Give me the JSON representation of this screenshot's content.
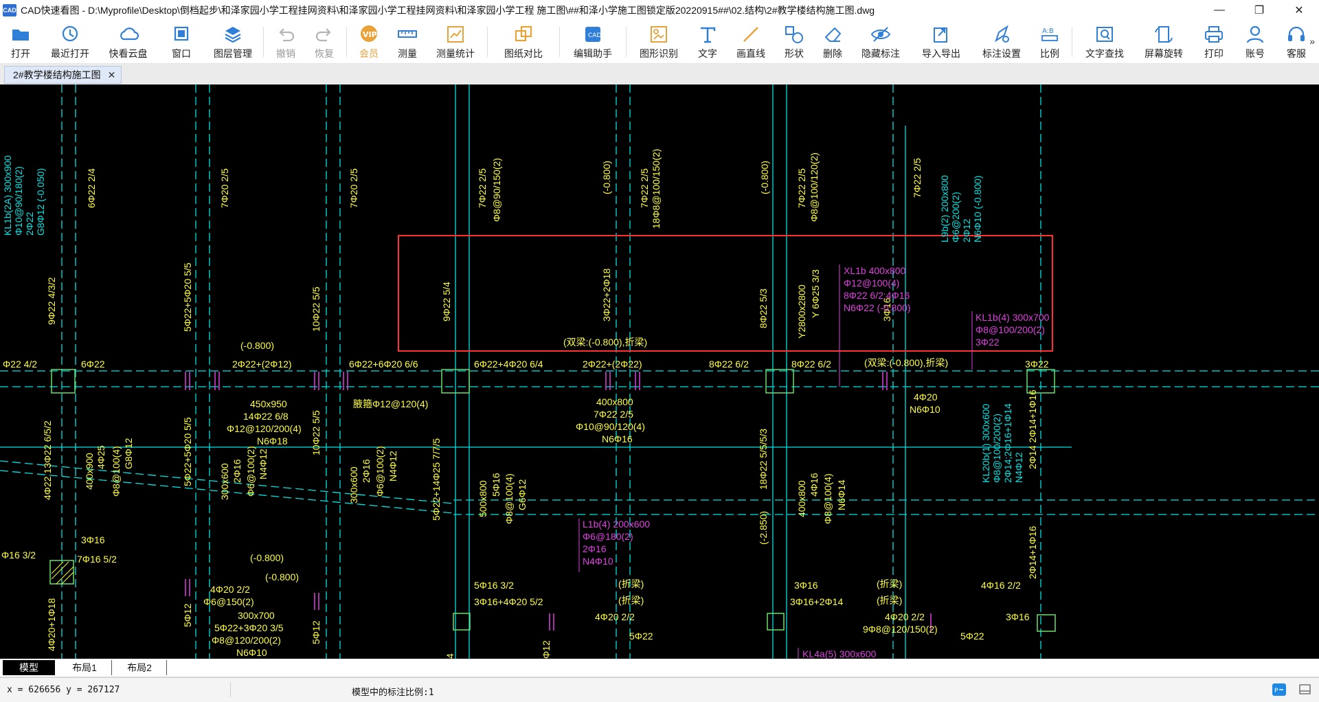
{
  "window": {
    "title": "CAD快速看图 - D:\\Myprofile\\Desktop\\倒档起步\\和泽家园小学工程挂网资料\\和泽家园小学工程挂网资料\\和泽家园小学工程 施工图\\##和泽小学施工图锁定版20220915##\\02.结构\\2#教学楼结构施工图.dwg",
    "app_icon_text": "CAD",
    "minimize": "—",
    "maximize": "❐",
    "close": "✕"
  },
  "toolbar": {
    "items": [
      {
        "label": "打开",
        "icon": "folder-open-icon",
        "color": "#2f7fd8"
      },
      {
        "label": "最近打开",
        "icon": "history-icon",
        "color": "#2f7fd8"
      },
      {
        "label": "快看云盘",
        "icon": "cloud-icon",
        "color": "#2f7fd8"
      },
      {
        "label": "窗口",
        "icon": "window-icon",
        "color": "#2f7fd8"
      },
      {
        "label": "图层管理",
        "icon": "layers-icon",
        "color": "#2f7fd8"
      },
      {
        "label": "撤销",
        "icon": "undo-icon",
        "color": "#b5b5b5"
      },
      {
        "label": "恢复",
        "icon": "redo-icon",
        "color": "#b5b5b5"
      },
      {
        "label": "会员",
        "icon": "vip-icon",
        "color": "#e8a23a"
      },
      {
        "label": "测量",
        "icon": "ruler-icon",
        "color": "#2f7fd8"
      },
      {
        "label": "测量统计",
        "icon": "measure-stats-icon",
        "color": "#e8a23a"
      },
      {
        "label": "图纸对比",
        "icon": "compare-icon",
        "color": "#e8a23a"
      },
      {
        "label": "编辑助手",
        "icon": "edit-assistant-icon",
        "color": "#2f7fd8"
      },
      {
        "label": "图形识别",
        "icon": "shape-recognition-icon",
        "color": "#e8a23a"
      },
      {
        "label": "文字",
        "icon": "text-icon",
        "color": "#2f7fd8"
      },
      {
        "label": "画直线",
        "icon": "line-icon",
        "color": "#e8a23a"
      },
      {
        "label": "形状",
        "icon": "shape-icon",
        "color": "#2f7fd8"
      },
      {
        "label": "删除",
        "icon": "eraser-icon",
        "color": "#2f7fd8"
      },
      {
        "label": "隐藏标注",
        "icon": "hide-annotation-icon",
        "color": "#2f7fd8"
      },
      {
        "label": "导入导出",
        "icon": "import-export-icon",
        "color": "#2f7fd8"
      },
      {
        "label": "标注设置",
        "icon": "annotation-settings-icon",
        "color": "#2f7fd8"
      },
      {
        "label": "比例",
        "icon": "scale-icon",
        "color": "#2f7fd8"
      },
      {
        "label": "文字查找",
        "icon": "text-search-icon",
        "color": "#2f7fd8"
      },
      {
        "label": "屏幕旋转",
        "icon": "rotate-screen-icon",
        "color": "#2f7fd8"
      },
      {
        "label": "打印",
        "icon": "printer-icon",
        "color": "#2f7fd8"
      },
      {
        "label": "账号",
        "icon": "user-icon",
        "color": "#2f7fd8"
      },
      {
        "label": "客服",
        "icon": "headset-icon",
        "color": "#2f7fd8"
      }
    ],
    "overflow": "»"
  },
  "document_tab": {
    "label": "2#教学楼结构施工图",
    "close": "✕"
  },
  "drawing": {
    "background": "#000000",
    "colors": {
      "cyan": "#00e5e5",
      "yellow": "#ffff3c",
      "magenta": "#e040e0",
      "green": "#6ce06c",
      "selection": "#ff3030",
      "white": "#cfcfcf"
    },
    "labels": {
      "kl1b2a": "KL1b(2A) 300x900",
      "kl1b2a_s": "Φ10@90/180(2)",
      "kl1b2a_c": "2Φ22",
      "kl1b2a_g": "G8Φ12 (-0.050)",
      "v6_22_24": "6Φ22 2/4",
      "v7_20_25a": "7Φ20 2/5",
      "v7_20_25b": "7Φ20 2/5",
      "v7_22_25a": "7Φ22 2/5",
      "v8_90": "Φ8@90/150(2)",
      "v_m0800a": "(-0.800)",
      "v7_22_25b": "7Φ22 2/5",
      "v18_8": "18Φ8@100/150(2)",
      "v_m0800b": "(-0.800)",
      "v7_22_25c": "7Φ22 2/5",
      "v8_100_120": "Φ8@100/120(2)",
      "v7_22_25d": "7Φ22 2/5",
      "l9b": "L9b(2) 200x800",
      "l9b_s": "Φ6@200(2)",
      "l9b_c": "2Φ12",
      "l9b_n": "N6Φ10 (-0.800)",
      "xl1b": "XL1b 400x800",
      "xl1b_s": "Φ12@100(4)",
      "xl1b_c": "8Φ22 6/2;4Φ16",
      "xl1b_n": "N6Φ22 (-0.800)",
      "kl1b4": "KL1b(4) 300x700",
      "kl1b4_s": "Φ8@100/200(2)",
      "kl1b4_c": "3Φ22",
      "v9_22_432": "9Φ22 4/3/2",
      "v5_22_20": "5Φ22+5Φ20 5/5",
      "v10_22_55": "10Φ22 5/5",
      "v9_22_54": "9Φ22 5/4",
      "v3_22_18": "3Φ22+2Φ18",
      "v8_22_53": "8Φ22 5/3",
      "y2800": "Y2800x2800",
      "y6": "Y 6Φ25 3/3",
      "v3_16": "3Φ16",
      "r22_42": "Φ22 4/2",
      "r6_22": "6Φ22",
      "r_m0800": "(-0.800)",
      "r2_22_12": "2Φ22+(2Φ12)",
      "r6_22_20_66": "6Φ22+6Φ20 6/6",
      "r6_22_20_64": "6Φ22+4Φ20 6/4",
      "r_double1": "(双梁:(-0.800),折梁)",
      "r2_22_22": "2Φ22+(2Φ22)",
      "r8_22_62a": "8Φ22 6/2",
      "r8_22_62b": "8Φ22 6/2",
      "r_double2": "(双梁:(-0.800),折梁)",
      "r3_22": "3Φ22",
      "b450": "450x950",
      "b450_c": "14Φ22 6/8",
      "b450_s": "Φ12@120/200(4)",
      "b450_n": "N6Φ18",
      "b_jiaju": "腋箍Φ12@120(4)",
      "b400": "400x800",
      "b400_c": "7Φ22 2/5",
      "b400_s": "Φ10@90/120(4)",
      "b400_n": "N6Φ16",
      "b4_20": "4Φ20",
      "b_n6_10": "N6Φ10",
      "v4_22_13": "4Φ22 13Φ22 6/5/2",
      "v400_900": "400x900",
      "v4_25": "4Φ25",
      "v8_100_4": "Φ8@100(4)",
      "v_g8_12": "G8Φ12",
      "v5_22_20b": "5Φ22+5Φ20 5/5",
      "v10_22_55b": "10Φ22 5/5",
      "v300_600": "300x600",
      "v2_16": "2Φ16",
      "v6_100": "Φ6@100(2)",
      "v_n4_12": "N4Φ12",
      "v300_600b": "300x600",
      "v2_16b": "2Φ16",
      "v6_100b": "Φ6@100(2)",
      "v_n4_12b": "N4Φ12",
      "v5_22_14": "5Φ22+14Φ25 7/7/5",
      "v500_800": "500x800",
      "v5_16": "5Φ16",
      "v8_100_4b": "Φ8@100(4)",
      "v_g6_12": "G6Φ12",
      "l1b": "L1b(4) 200x600",
      "l1b_s": "Φ6@180(2)",
      "l1b_c": "2Φ16",
      "l1b_n": "N4Φ10",
      "v18_22": "18Φ22 5/5/5/3",
      "v_m2850": "(-2.850)",
      "v400_800": "400x800",
      "v4_16": "4Φ16",
      "v8_100_4c": "Φ8@100(4)",
      "v_n6_14": "N6Φ14",
      "kl20b": "KL20b(1) 300x600",
      "kl20b_s": "Φ8@100/200(2)",
      "kl20b_c": "2Φ14;2Φ16+1Φ14",
      "kl20b_n": "N4Φ12",
      "v2_14_16": "2Φ14 2Φ14+1Φ16",
      "v2_14_16b": "2Φ14+1Φ16",
      "l3_16": "3Φ16",
      "l_16_32": "Φ16 3/2",
      "l7_16": "7Φ16 5/2",
      "l_m0800a": "(-0.800)",
      "l_m0800b": "(-0.800)",
      "l4_20_22": "4Φ20 2/2",
      "l6_150": "Φ6@150(2)",
      "l300_700": "300x700",
      "l5_22_3": "5Φ22+3Φ20 3/5",
      "l8_120": "Φ8@120/200(2)",
      "l_n6_10": "N6Φ10",
      "l4_20_18": "4Φ20+1Φ18",
      "l5_12a": "5Φ12",
      "l5_12b": "5Φ12",
      "l5_16_32": "5Φ16 3/2",
      "l3_16_4_20": "3Φ16+4Φ20 5/2",
      "l4_20_22b": "4Φ20 2/2",
      "l5_22": "5Φ22",
      "l_zheliang1": "(折梁)",
      "l_zheliang2": "(折梁)",
      "l3_16b": "3Φ16",
      "l3_16_2_14": "3Φ16+2Φ14",
      "l_zheliang3": "(折梁)",
      "l_zheliang4": "(折梁)",
      "l4_20_22c": "4Φ20 2/2",
      "l9_8": "9Φ8@120/150(2)",
      "l4_16_22": "4Φ16 2/2",
      "l3_16c": "3Φ16",
      "l5_22b": "5Φ22",
      "kl4a": "KL4a(5) 300x600",
      "v_12a": "Φ12",
      "v_4a": "4"
    }
  },
  "layout_tabs": [
    {
      "label": "模型",
      "active": true
    },
    {
      "label": "布局1",
      "active": false
    },
    {
      "label": "布局2",
      "active": false
    }
  ],
  "status": {
    "coords": "x = 626656  y = 267127",
    "scale_text": "模型中的标注比例:1"
  }
}
